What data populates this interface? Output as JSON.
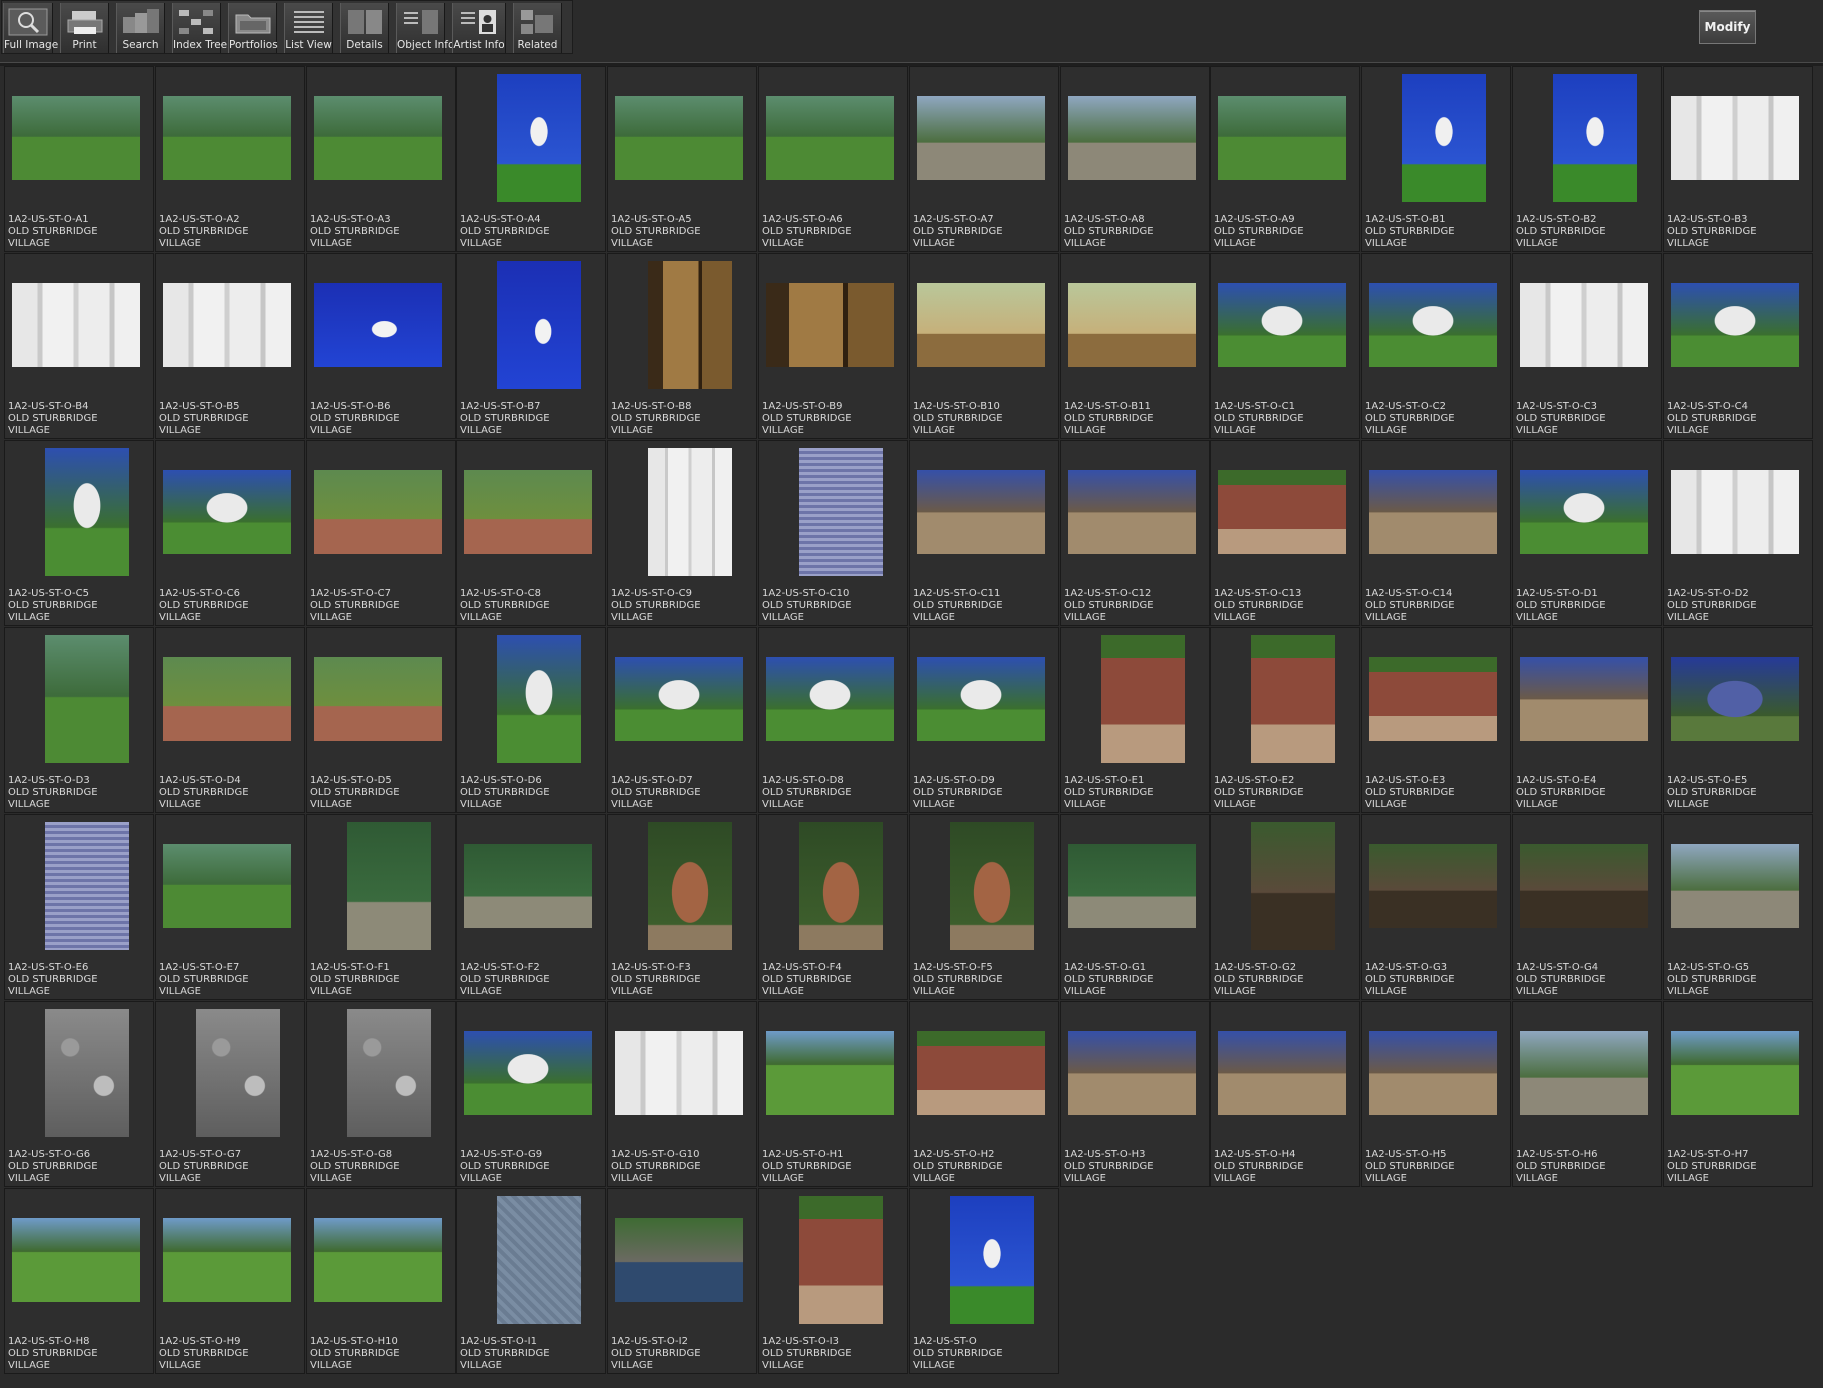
{
  "toolbar": {
    "buttons": [
      {
        "label": "Full Image",
        "icon": "magnifier-icon"
      },
      {
        "label": "Print",
        "icon": "printer-icon"
      },
      {
        "label": "Search",
        "icon": "search-icon"
      },
      {
        "label": "Index Tree",
        "icon": "index-tree-icon"
      },
      {
        "label": "Portfolios",
        "icon": "portfolio-icon"
      },
      {
        "label": "List View",
        "icon": "list-view-icon"
      },
      {
        "label": "Details",
        "icon": "details-icon"
      },
      {
        "label": "Object Info",
        "icon": "object-info-icon"
      },
      {
        "label": "Artist  Info",
        "icon": "artist-info-icon"
      },
      {
        "label": "Related",
        "icon": "related-icon"
      }
    ]
  },
  "modify_label": "Modify",
  "collection": {
    "line2": "OLD STURBRIDGE",
    "line3": "VILLAGE"
  },
  "items": [
    {
      "code": "1A2-US-ST-O-A1",
      "orient": "l",
      "scene": "green"
    },
    {
      "code": "1A2-US-ST-O-A2",
      "orient": "l",
      "scene": "green"
    },
    {
      "code": "1A2-US-ST-O-A3",
      "orient": "l",
      "scene": "green"
    },
    {
      "code": "1A2-US-ST-O-A4",
      "orient": "p",
      "scene": "church"
    },
    {
      "code": "1A2-US-ST-O-A5",
      "orient": "l",
      "scene": "green"
    },
    {
      "code": "1A2-US-ST-O-A6",
      "orient": "l",
      "scene": "green"
    },
    {
      "code": "1A2-US-ST-O-A7",
      "orient": "l",
      "scene": "road"
    },
    {
      "code": "1A2-US-ST-O-A8",
      "orient": "l",
      "scene": "road"
    },
    {
      "code": "1A2-US-ST-O-A9",
      "orient": "l",
      "scene": "green"
    },
    {
      "code": "1A2-US-ST-O-B1",
      "orient": "p",
      "scene": "church"
    },
    {
      "code": "1A2-US-ST-O-B2",
      "orient": "p",
      "scene": "church"
    },
    {
      "code": "1A2-US-ST-O-B3",
      "orient": "l",
      "scene": "white"
    },
    {
      "code": "1A2-US-ST-O-B4",
      "orient": "l",
      "scene": "white"
    },
    {
      "code": "1A2-US-ST-O-B5",
      "orient": "l",
      "scene": "white"
    },
    {
      "code": "1A2-US-ST-O-B6",
      "orient": "l",
      "scene": "sky"
    },
    {
      "code": "1A2-US-ST-O-B7",
      "orient": "p",
      "scene": "sky"
    },
    {
      "code": "1A2-US-ST-O-B8",
      "orient": "p",
      "scene": "interior"
    },
    {
      "code": "1A2-US-ST-O-B9",
      "orient": "l",
      "scene": "interior"
    },
    {
      "code": "1A2-US-ST-O-B10",
      "orient": "l",
      "scene": "hall"
    },
    {
      "code": "1A2-US-ST-O-B11",
      "orient": "l",
      "scene": "hall"
    },
    {
      "code": "1A2-US-ST-O-C1",
      "orient": "l",
      "scene": "house"
    },
    {
      "code": "1A2-US-ST-O-C2",
      "orient": "l",
      "scene": "house"
    },
    {
      "code": "1A2-US-ST-O-C3",
      "orient": "l",
      "scene": "white"
    },
    {
      "code": "1A2-US-ST-O-C4",
      "orient": "l",
      "scene": "house"
    },
    {
      "code": "1A2-US-ST-O-C5",
      "orient": "p",
      "scene": "house"
    },
    {
      "code": "1A2-US-ST-O-C6",
      "orient": "l",
      "scene": "house"
    },
    {
      "code": "1A2-US-ST-O-C7",
      "orient": "l",
      "scene": "garden"
    },
    {
      "code": "1A2-US-ST-O-C8",
      "orient": "l",
      "scene": "garden"
    },
    {
      "code": "1A2-US-ST-O-C9",
      "orient": "p",
      "scene": "white"
    },
    {
      "code": "1A2-US-ST-O-C10",
      "orient": "p",
      "scene": "shutter"
    },
    {
      "code": "1A2-US-ST-O-C11",
      "orient": "l",
      "scene": "barn"
    },
    {
      "code": "1A2-US-ST-O-C12",
      "orient": "l",
      "scene": "barn"
    },
    {
      "code": "1A2-US-ST-O-C13",
      "orient": "l",
      "scene": "brick"
    },
    {
      "code": "1A2-US-ST-O-C14",
      "orient": "l",
      "scene": "barn"
    },
    {
      "code": "1A2-US-ST-O-D1",
      "orient": "l",
      "scene": "house"
    },
    {
      "code": "1A2-US-ST-O-D2",
      "orient": "l",
      "scene": "white"
    },
    {
      "code": "1A2-US-ST-O-D3",
      "orient": "p",
      "scene": "green"
    },
    {
      "code": "1A2-US-ST-O-D4",
      "orient": "l",
      "scene": "garden"
    },
    {
      "code": "1A2-US-ST-O-D5",
      "orient": "l",
      "scene": "garden"
    },
    {
      "code": "1A2-US-ST-O-D6",
      "orient": "p",
      "scene": "house"
    },
    {
      "code": "1A2-US-ST-O-D7",
      "orient": "l",
      "scene": "house"
    },
    {
      "code": "1A2-US-ST-O-D8",
      "orient": "l",
      "scene": "house"
    },
    {
      "code": "1A2-US-ST-O-D9",
      "orient": "l",
      "scene": "house"
    },
    {
      "code": "1A2-US-ST-O-E1",
      "orient": "p",
      "scene": "brick"
    },
    {
      "code": "1A2-US-ST-O-E2",
      "orient": "p",
      "scene": "brick"
    },
    {
      "code": "1A2-US-ST-O-E3",
      "orient": "l",
      "scene": "brick"
    },
    {
      "code": "1A2-US-ST-O-E4",
      "orient": "l",
      "scene": "barn"
    },
    {
      "code": "1A2-US-ST-O-E5",
      "orient": "l",
      "scene": "blue"
    },
    {
      "code": "1A2-US-ST-O-E6",
      "orient": "p",
      "scene": "shutter"
    },
    {
      "code": "1A2-US-ST-O-E7",
      "orient": "l",
      "scene": "green"
    },
    {
      "code": "1A2-US-ST-O-F1",
      "orient": "p",
      "scene": "forest"
    },
    {
      "code": "1A2-US-ST-O-F2",
      "orient": "l",
      "scene": "forest"
    },
    {
      "code": "1A2-US-ST-O-F3",
      "orient": "p",
      "scene": "kiln"
    },
    {
      "code": "1A2-US-ST-O-F4",
      "orient": "p",
      "scene": "kiln"
    },
    {
      "code": "1A2-US-ST-O-F5",
      "orient": "p",
      "scene": "kiln"
    },
    {
      "code": "1A2-US-ST-O-G1",
      "orient": "l",
      "scene": "forest"
    },
    {
      "code": "1A2-US-ST-O-G2",
      "orient": "p",
      "scene": "mill"
    },
    {
      "code": "1A2-US-ST-O-G3",
      "orient": "l",
      "scene": "mill"
    },
    {
      "code": "1A2-US-ST-O-G4",
      "orient": "l",
      "scene": "mill"
    },
    {
      "code": "1A2-US-ST-O-G5",
      "orient": "l",
      "scene": "road"
    },
    {
      "code": "1A2-US-ST-O-G6",
      "orient": "p",
      "scene": "stone"
    },
    {
      "code": "1A2-US-ST-O-G7",
      "orient": "p",
      "scene": "stone"
    },
    {
      "code": "1A2-US-ST-O-G8",
      "orient": "p",
      "scene": "stone"
    },
    {
      "code": "1A2-US-ST-O-G9",
      "orient": "l",
      "scene": "house"
    },
    {
      "code": "1A2-US-ST-O-G10",
      "orient": "l",
      "scene": "white"
    },
    {
      "code": "1A2-US-ST-O-H1",
      "orient": "l",
      "scene": "field"
    },
    {
      "code": "1A2-US-ST-O-H2",
      "orient": "l",
      "scene": "brick"
    },
    {
      "code": "1A2-US-ST-O-H3",
      "orient": "l",
      "scene": "barn"
    },
    {
      "code": "1A2-US-ST-O-H4",
      "orient": "l",
      "scene": "barn"
    },
    {
      "code": "1A2-US-ST-O-H5",
      "orient": "l",
      "scene": "barn"
    },
    {
      "code": "1A2-US-ST-O-H6",
      "orient": "l",
      "scene": "road"
    },
    {
      "code": "1A2-US-ST-O-H7",
      "orient": "l",
      "scene": "field"
    },
    {
      "code": "1A2-US-ST-O-H8",
      "orient": "l",
      "scene": "field"
    },
    {
      "code": "1A2-US-ST-O-H9",
      "orient": "l",
      "scene": "field"
    },
    {
      "code": "1A2-US-ST-O-H10",
      "orient": "l",
      "scene": "field"
    },
    {
      "code": "1A2-US-ST-O-I1",
      "orient": "p",
      "scene": "map"
    },
    {
      "code": "1A2-US-ST-O-I2",
      "orient": "l",
      "scene": "water"
    },
    {
      "code": "1A2-US-ST-O-I3",
      "orient": "p",
      "scene": "brick"
    },
    {
      "code": "1A2-US-ST-O",
      "orient": "p",
      "scene": "church"
    }
  ],
  "colors": {
    "background": "#2b2b2b",
    "cell": "#2e2e2e",
    "caption": "#d9d9d9"
  }
}
